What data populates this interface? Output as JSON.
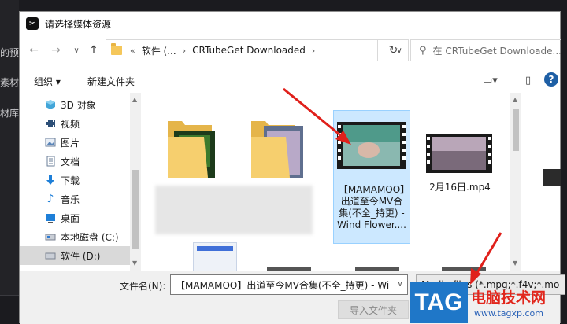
{
  "background": {
    "left_labels": [
      "的预",
      "素材",
      "材库"
    ]
  },
  "dialog": {
    "title": "请选择媒体资源",
    "nav": {
      "back": "←",
      "forward": "→",
      "recent": "∨",
      "up": "↑",
      "crumb_prefix": "«",
      "crumbs": [
        "软件 (...",
        "CRTubeGet Downloaded"
      ],
      "refresh": "↻",
      "search_placeholder": "在 CRTubeGet Downloade..."
    },
    "toolbar": {
      "organize": "组织 ▾",
      "new_folder": "新建文件夹"
    },
    "sidebar": {
      "items": [
        {
          "label": "3D 对象",
          "icon": "cube-icon"
        },
        {
          "label": "视频",
          "icon": "video-icon"
        },
        {
          "label": "图片",
          "icon": "picture-icon"
        },
        {
          "label": "文档",
          "icon": "document-icon"
        },
        {
          "label": "下载",
          "icon": "download-icon"
        },
        {
          "label": "音乐",
          "icon": "music-icon"
        },
        {
          "label": "桌面",
          "icon": "desktop-icon"
        },
        {
          "label": "本地磁盘 (C:)",
          "icon": "drive-icon"
        },
        {
          "label": "软件 (D:)",
          "icon": "drive-icon"
        }
      ],
      "selected_index": 8
    },
    "files": [
      {
        "caption": "",
        "kind": "folder"
      },
      {
        "caption": "",
        "kind": "folder"
      },
      {
        "caption": "【MAMAMOO】出道至今MV合集(不全_持更) - Wind Flower....",
        "kind": "video",
        "selected": true
      },
      {
        "caption": "2月16日.mp4",
        "kind": "video"
      }
    ],
    "filename_label": "文件名(N):",
    "filename_value": "【MAMAMOO】出道至今MV合集(不全_持更) - Wi",
    "filetype_value": "Media files (*.mpg;*.f4v;*.mo",
    "import_button": "导入文件夹"
  },
  "watermark": {
    "tag": "TAG",
    "text": "电脑技术网",
    "url": "www.tagxp.com"
  },
  "colors": {
    "accent": "#1e5fa5",
    "selection": "#cce8ff",
    "annotation_arrow": "#e0201b"
  }
}
